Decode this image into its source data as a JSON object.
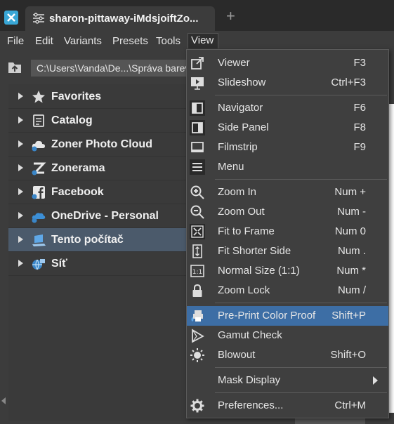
{
  "window": {
    "tab_title": "sharon-pittaway-iMdsjoiftZo..."
  },
  "menubar": [
    "File",
    "Edit",
    "Variants",
    "Presets",
    "Tools",
    "View"
  ],
  "path": "C:\\Users\\Vanda\\De...\\Správa barev",
  "tree": [
    {
      "label": "Favorites",
      "icon": "star-icon"
    },
    {
      "label": "Catalog",
      "icon": "catalog-icon"
    },
    {
      "label": "Zoner Photo Cloud",
      "icon": "cloud-icon"
    },
    {
      "label": "Zonerama",
      "icon": "zonerama-icon"
    },
    {
      "label": "Facebook",
      "icon": "facebook-icon"
    },
    {
      "label": "OneDrive - Personal",
      "icon": "onedrive-icon"
    },
    {
      "label": "Tento počítač",
      "icon": "computer-icon"
    },
    {
      "label": "Síť",
      "icon": "network-icon"
    }
  ],
  "view_menu": [
    {
      "label": "Viewer",
      "shortcut": "F3",
      "icon": "viewer-icon"
    },
    {
      "label": "Slideshow",
      "shortcut": "Ctrl+F3",
      "icon": "slideshow-icon"
    },
    {
      "label": "Navigator",
      "shortcut": "F6",
      "icon": "navigator-icon"
    },
    {
      "label": "Side Panel",
      "shortcut": "F8",
      "icon": "side-panel-icon"
    },
    {
      "label": "Filmstrip",
      "shortcut": "F9",
      "icon": "filmstrip-icon"
    },
    {
      "label": "Menu",
      "shortcut": "",
      "icon": "menu-icon"
    },
    {
      "label": "Zoom In",
      "shortcut": "Num +",
      "icon": "zoom-in-icon"
    },
    {
      "label": "Zoom Out",
      "shortcut": "Num -",
      "icon": "zoom-out-icon"
    },
    {
      "label": "Fit to Frame",
      "shortcut": "Num 0",
      "icon": "fit-to-frame-icon"
    },
    {
      "label": "Fit Shorter Side",
      "shortcut": "Num .",
      "icon": "fit-shorter-side-icon"
    },
    {
      "label": "Normal Size (1:1)",
      "shortcut": "Num *",
      "icon": "normal-size-icon"
    },
    {
      "label": "Zoom Lock",
      "shortcut": "Num /",
      "icon": "lock-icon"
    },
    {
      "label": "Pre-Print Color Proof",
      "shortcut": "Shift+P",
      "icon": "color-proof-icon"
    },
    {
      "label": "Gamut Check",
      "shortcut": "",
      "icon": "gamut-icon"
    },
    {
      "label": "Blowout",
      "shortcut": "Shift+O",
      "icon": "blowout-icon"
    },
    {
      "label": "Mask Display",
      "shortcut": "",
      "icon": ""
    },
    {
      "label": "Preferences...",
      "shortcut": "Ctrl+M",
      "icon": "gear-icon"
    }
  ],
  "colors": {
    "highlight": "#3d6ea5",
    "selected_node": "#4b5a6b",
    "app_accent": "#39a7d6"
  }
}
